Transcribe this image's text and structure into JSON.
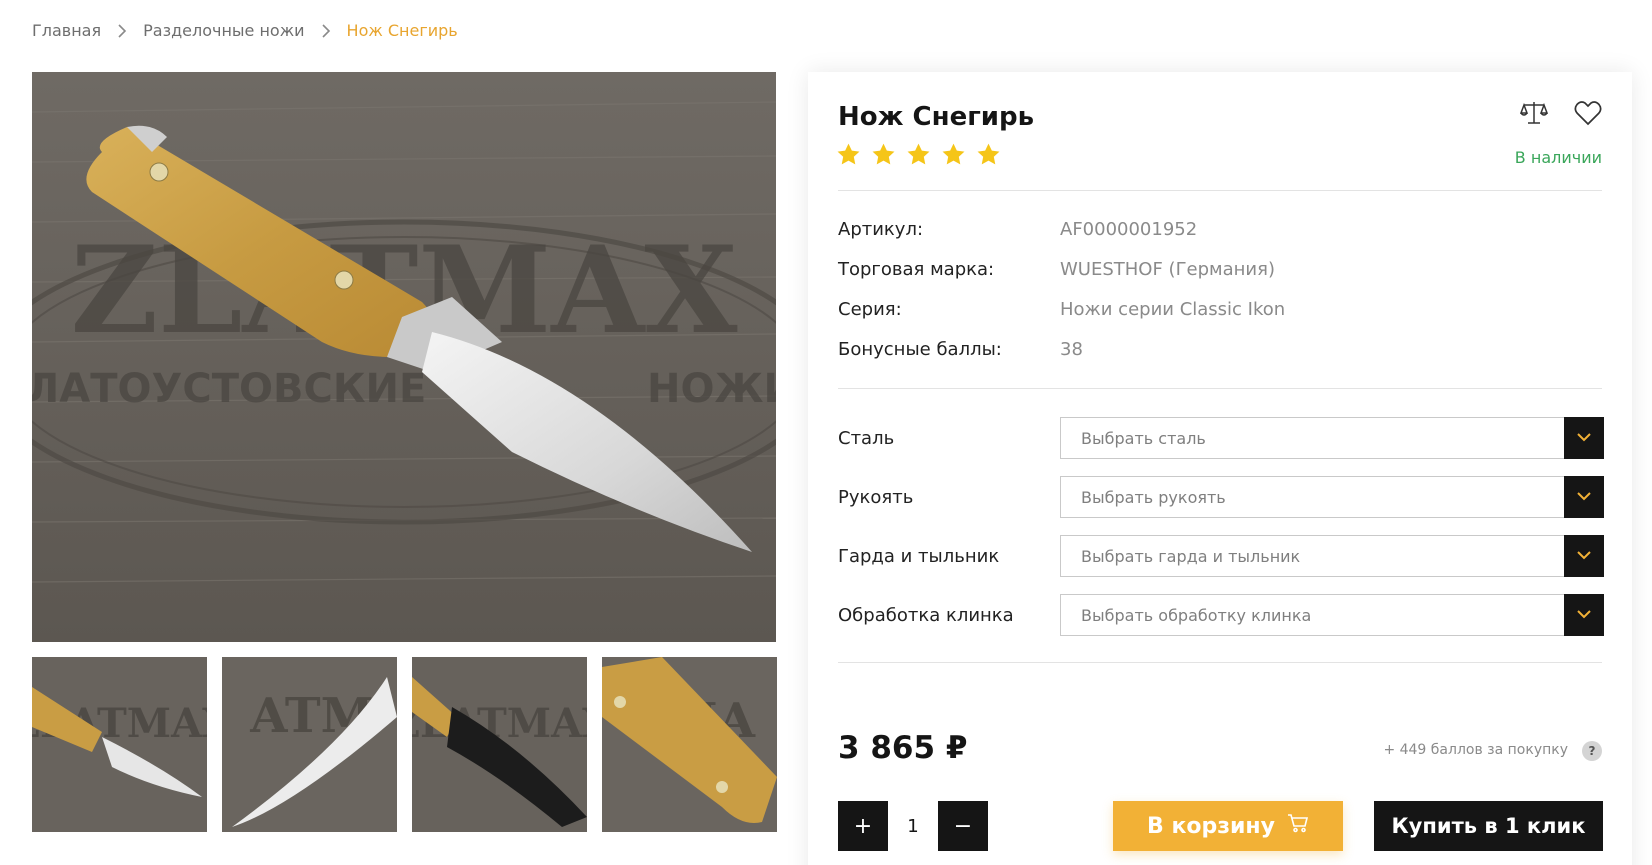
{
  "breadcrumb": {
    "items": [
      "Главная",
      "Разделочные ножи"
    ],
    "current": "Нож Снегирь"
  },
  "gallery": {
    "main_image": "knife-photo",
    "thumbnails": [
      "knife-thumb-1",
      "knife-thumb-2",
      "knife-thumb-3",
      "knife-thumb-4"
    ]
  },
  "product": {
    "title": "Нож Снегирь",
    "rating": 5,
    "rating_max": 5,
    "stock": "В наличии",
    "icons": [
      "compare-scales-icon",
      "heart-icon"
    ],
    "specs": [
      {
        "label": "Артикул:",
        "value": "AF0000001952"
      },
      {
        "label": "Торговая марка:",
        "value": "WUESTHOF (Германия)"
      },
      {
        "label": "Серия:",
        "value": "Ножи серии Classic Ikon"
      },
      {
        "label": "Бонусные баллы:",
        "value": "38"
      }
    ],
    "options": [
      {
        "label": "Сталь",
        "placeholder": "Выбрать сталь"
      },
      {
        "label": "Рукоять",
        "placeholder": "Выбрать рукоять"
      },
      {
        "label": "Гарда и тыльник",
        "placeholder": "Выбрать гарда и тыльник"
      },
      {
        "label": "Обработка клинка",
        "placeholder": "Выбрать обработку клинка"
      }
    ],
    "price": "3 865 ₽",
    "bonus_note": "+ 449 баллов за покупку",
    "help": "?",
    "quantity": "1",
    "plus": "+",
    "minus": "−",
    "cart_label": "В корзину",
    "one_click_label": "Купить в 1 клик"
  },
  "colors": {
    "accent": "#f2b136",
    "breadcrumb_current": "#e8a52f",
    "stock": "#3aa65a",
    "dark": "#151515",
    "star": "#f5c518"
  }
}
